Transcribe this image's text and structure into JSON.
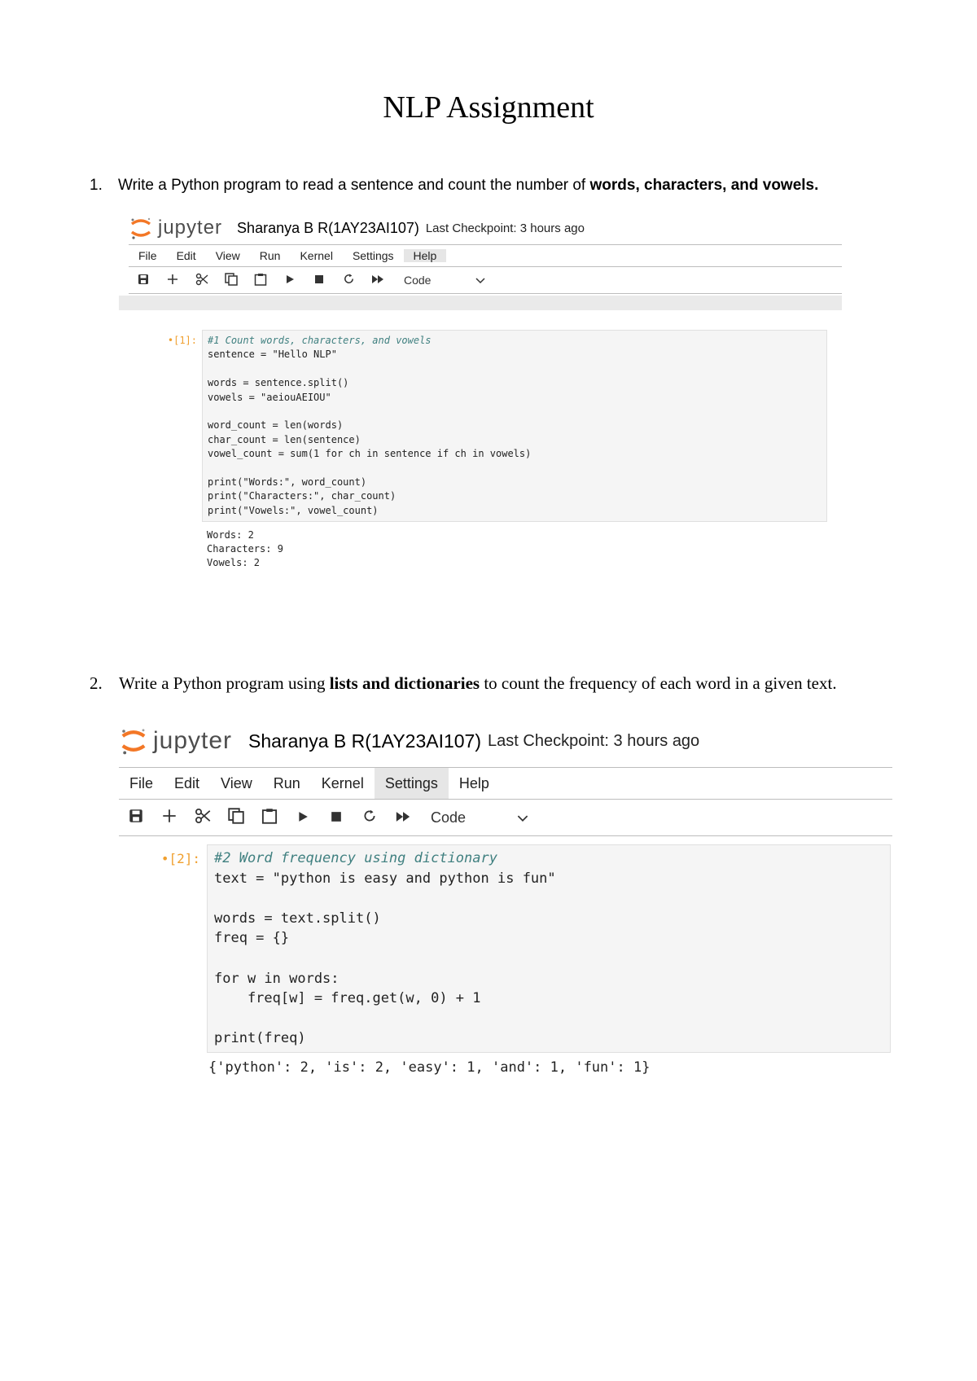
{
  "title": "NLP Assignment",
  "questions": [
    {
      "number": "1.",
      "text_plain": "Write a Python program to read a sentence and count the number of ",
      "text_bold": "words, characters, and vowels."
    },
    {
      "number": "2.",
      "text_before": "Write a Python program using ",
      "text_bold": "lists and dictionaries",
      "text_after": " to count the frequency of each word in a given text."
    }
  ],
  "notebook": {
    "wordmark": "jupyter",
    "name": "Sharanya B R(1AY23AI107)",
    "checkpoint": "Last Checkpoint: 3 hours ago",
    "menu": [
      "File",
      "Edit",
      "View",
      "Run",
      "Kernel",
      "Settings",
      "Help"
    ],
    "cell_type": "Code",
    "toolbar_icons": [
      "save-icon",
      "plus-icon",
      "scissors-icon",
      "copy-icon",
      "paste-icon",
      "play-icon",
      "stop-icon",
      "restart-icon",
      "fast-forward-icon"
    ]
  },
  "cell1": {
    "prompt": "•[1]:",
    "code": [
      "#1 Count words, characters, and vowels",
      "sentence = \"Hello NLP\"",
      "",
      "words = sentence.split()",
      "vowels = \"aeiouAEIOU\"",
      "",
      "word_count = len(words)",
      "char_count = len(sentence)",
      "vowel_count = sum(1 for ch in sentence if ch in vowels)",
      "",
      "print(\"Words:\", word_count)",
      "print(\"Characters:\", char_count)",
      "print(\"Vowels:\", vowel_count)"
    ],
    "output": [
      "Words: 2",
      "Characters: 9",
      "Vowels: 2"
    ]
  },
  "cell2": {
    "prompt": "•[2]:",
    "code": [
      "#2 Word frequency using dictionary",
      "text = \"python is easy and python is fun\"",
      "",
      "words = text.split()",
      "freq = {}",
      "",
      "for w in words:",
      "    freq[w] = freq.get(w, 0) + 1",
      "",
      "print(freq)"
    ],
    "output": [
      "{'python': 2, 'is': 2, 'easy': 1, 'and': 1, 'fun': 1}"
    ]
  }
}
